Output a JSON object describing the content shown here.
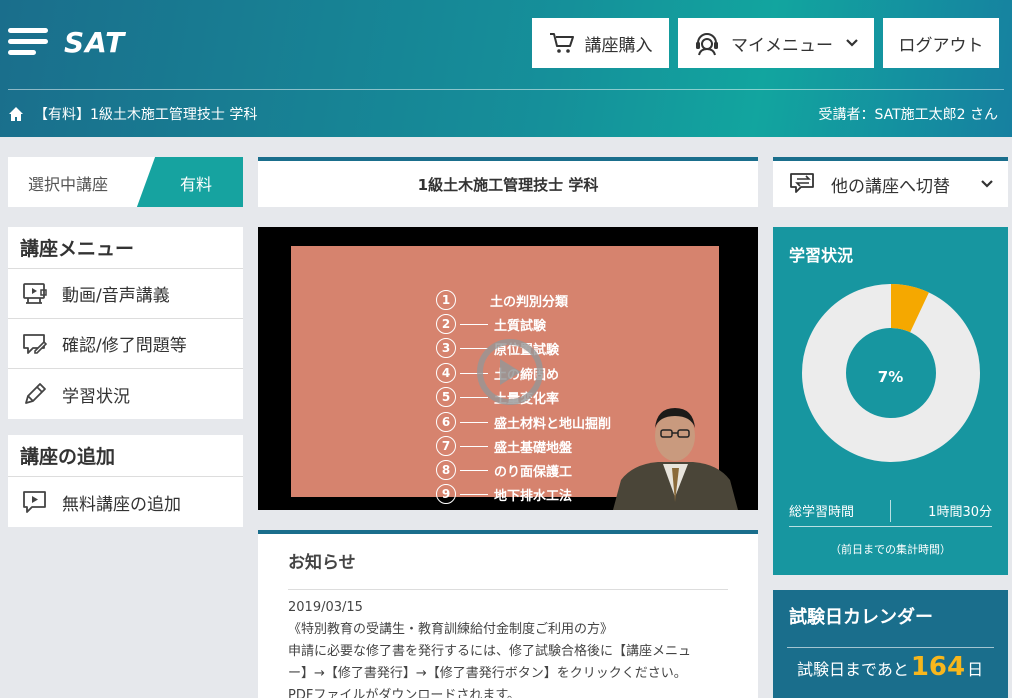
{
  "header": {
    "logo_text": "SAT",
    "buttons": {
      "purchase": "講座購入",
      "my_menu": "マイメニュー",
      "logout": "ログアウト"
    },
    "breadcrumb": "【有料】1級土木施工管理技士 学科",
    "student": "受講者：SAT施工太郎2 さん"
  },
  "left": {
    "selected": {
      "label": "選択中講座",
      "tag": "有料"
    },
    "course_menu": {
      "title": "講座メニュー",
      "items": [
        {
          "label": "動画/音声講義",
          "icon": "video-lecture-icon"
        },
        {
          "label": "確認/修了問題等",
          "icon": "quiz-icon"
        },
        {
          "label": "学習状況",
          "icon": "pencil-icon"
        }
      ]
    },
    "add_course": {
      "title": "講座の追加",
      "items": [
        {
          "label": "無料講座の追加",
          "icon": "play-comment-icon"
        }
      ]
    }
  },
  "center": {
    "course_title": "1級土木施工管理技士 学科",
    "video": {
      "slide_items": [
        {
          "num": "1",
          "text": "土の判別分類"
        },
        {
          "num": "2",
          "text": "土質試験"
        },
        {
          "num": "3",
          "text": "原位置試験"
        },
        {
          "num": "4",
          "text": "土の締固め"
        },
        {
          "num": "5",
          "text": "土量変化率"
        },
        {
          "num": "6",
          "text": "盛土材料と地山掘削"
        },
        {
          "num": "7",
          "text": "盛土基礎地盤"
        },
        {
          "num": "8",
          "text": "のり面保護工"
        },
        {
          "num": "9",
          "text": "地下排水工法"
        }
      ]
    },
    "news": {
      "title": "お知らせ",
      "date": "2019/03/15",
      "lines": [
        "《特別教育の受講生・教育訓練給付金制度ご利用の方》",
        "申請に必要な修了書を発行するには、修了試験合格後に【講座メニュ",
        "ー】→【修了書発行】→【修了書発行ボタン】をクリックください。",
        "PDFファイルがダウンロードされます。"
      ]
    }
  },
  "right": {
    "switch_label": "他の講座へ切替",
    "status": {
      "title": "学習状況",
      "progress_percent": 7,
      "percent_label": "7%",
      "total_label": "総学習時間",
      "total_value": "1時間30分",
      "note": "（前日までの集計時間）"
    },
    "calendar": {
      "title": "試験日カレンダー",
      "prefix": "試験日まであと",
      "days": "164",
      "suffix": "日"
    }
  },
  "colors": {
    "primary": "#1a6e8c",
    "teal": "#16a3a0",
    "status_bg": "#1796a0",
    "donut_fill": "#f5a800",
    "donut_track": "#ececec",
    "highlight": "#f7b71c"
  }
}
